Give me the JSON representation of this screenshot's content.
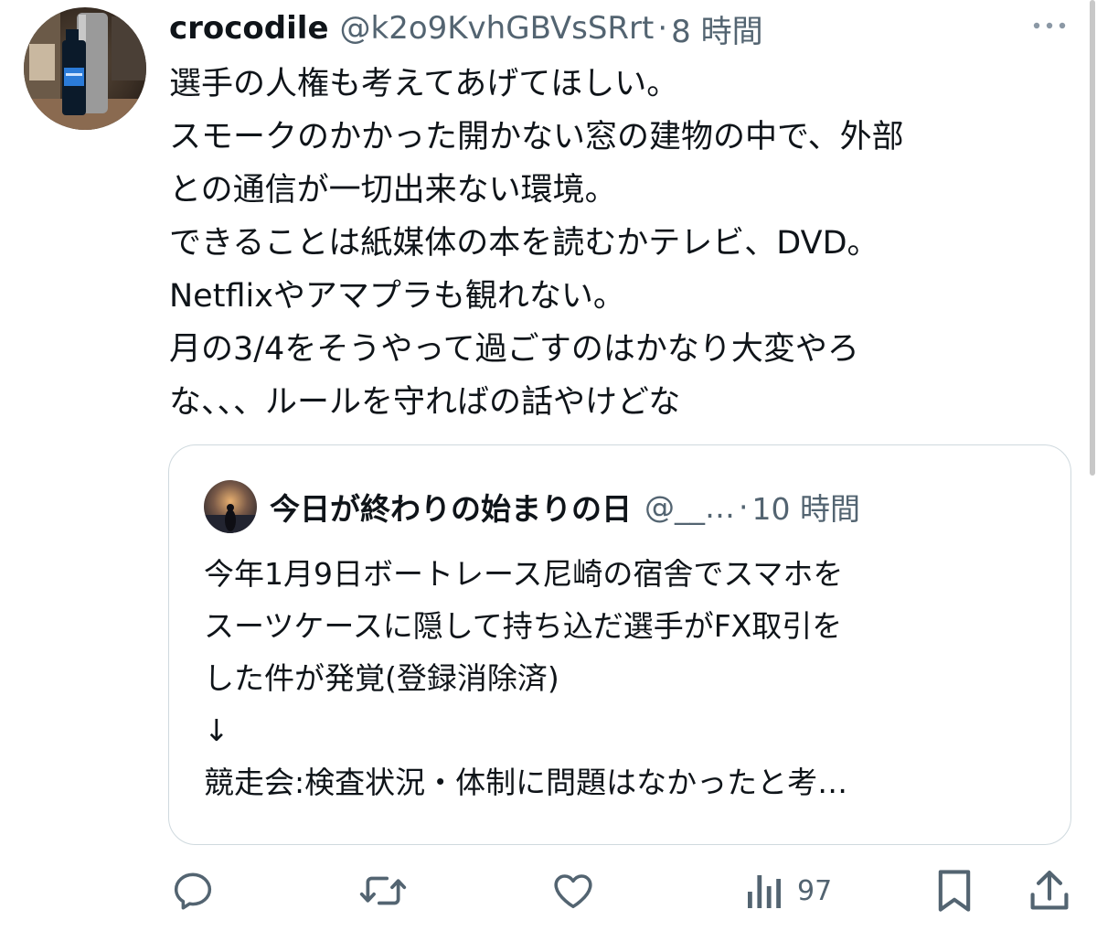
{
  "tweet": {
    "display_name": "crocodile",
    "handle": "@k2o9KvhGBVsSRrt",
    "separator": "·",
    "time": "8 時間",
    "body_lines": [
      "選手の人権も考えてあげてほしい。",
      "スモークのかかった開かない窓の建物の中で、外部",
      "との通信が一切出来ない環境。",
      "できることは紙媒体の本を読むかテレビ、DVD。",
      "Netflixやアマプラも観れない。",
      "月の3/4をそうやって過ごすのはかなり大変やろ",
      "な、、、ルールを守ればの話やけどな"
    ]
  },
  "quote": {
    "display_name": "今日が終わりの始まりの日",
    "handle": "@__…",
    "separator": "·",
    "time": "10 時間",
    "body_lines": [
      "今年1月9日ボートレース尼崎の宿舎でスマホを",
      "スーツケースに隠して持ち込だ選手がFX取引を",
      "した件が発覚(登録消除済)",
      "↓",
      "競走会:検査状況・体制に問題はなかったと考…"
    ]
  },
  "actions": {
    "reply_icon": "reply-icon",
    "retweet_icon": "retweet-icon",
    "like_icon": "heart-icon",
    "views_icon": "views-icon",
    "views_count": "97",
    "bookmark_icon": "bookmark-icon",
    "share_icon": "share-icon"
  },
  "colors": {
    "text_primary": "#0f1419",
    "text_secondary": "#536471",
    "border": "#cfd9de"
  }
}
